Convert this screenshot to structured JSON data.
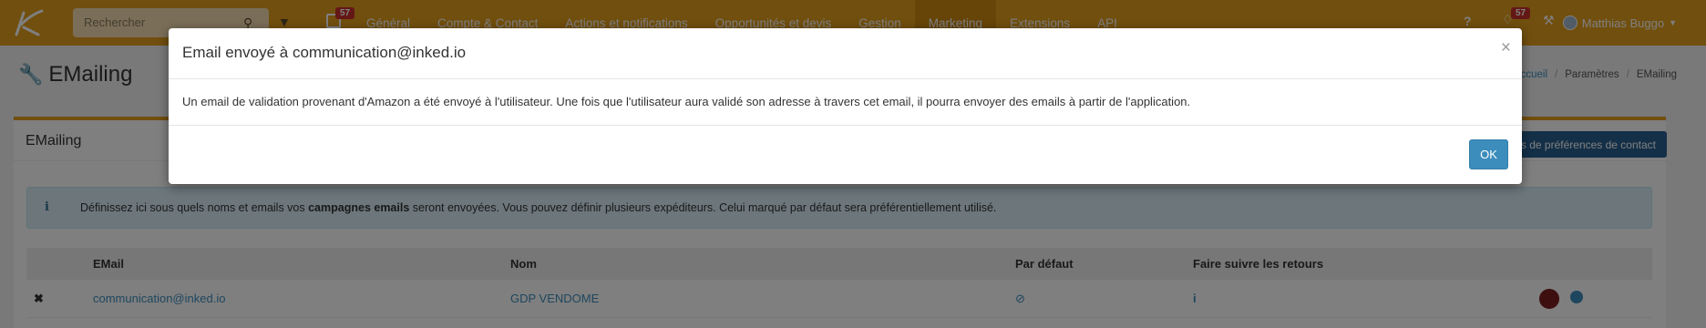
{
  "search": {
    "placeholder": "Rechercher"
  },
  "nav": {
    "calendar_badge": "57",
    "items": [
      {
        "label": "Général"
      },
      {
        "label": "Compte & Contact"
      },
      {
        "label": "Actions et notifications"
      },
      {
        "label": "Opportunités et devis"
      },
      {
        "label": "Gestion"
      },
      {
        "label": "Marketing"
      },
      {
        "label": "Extensions"
      },
      {
        "label": "API"
      }
    ],
    "notif_badge": "57",
    "user_name": "Matthias Buggo"
  },
  "page": {
    "title": "EMailing",
    "breadcrumb": [
      "Accueil",
      "Paramètres",
      "EMailing"
    ]
  },
  "box": {
    "title": "EMailing",
    "prefs_button": "ges de préférences de contact",
    "info_before": "Définissez ici sous quels noms et emails vos ",
    "info_bold": "campagnes emails",
    "info_after": " seront envoyées. Vous pouvez définir plusieurs expéditeurs. Celui marqué par défaut sera préférentiellement utilisé."
  },
  "table": {
    "headers": {
      "email": "EMail",
      "name": "Nom",
      "default": "Par défaut",
      "follow": "Faire suivre les retours"
    },
    "rows": [
      {
        "email": "communication@inked.io",
        "name": "GDP VENDOME"
      }
    ]
  },
  "modal": {
    "title": "Email envoyé à communication@inked.io",
    "body": "Un email de validation provenant d'Amazon a été envoyé à l'utilisateur. Une fois que l'utilisateur aura validé son adresse à travers cet email, il pourra envoyer des emails à partir de l'application.",
    "ok_label": "OK",
    "close_glyph": "×"
  },
  "colors": {
    "accent": "#e39e1c",
    "primary": "#3c8dbc",
    "danger": "#c9302c"
  }
}
